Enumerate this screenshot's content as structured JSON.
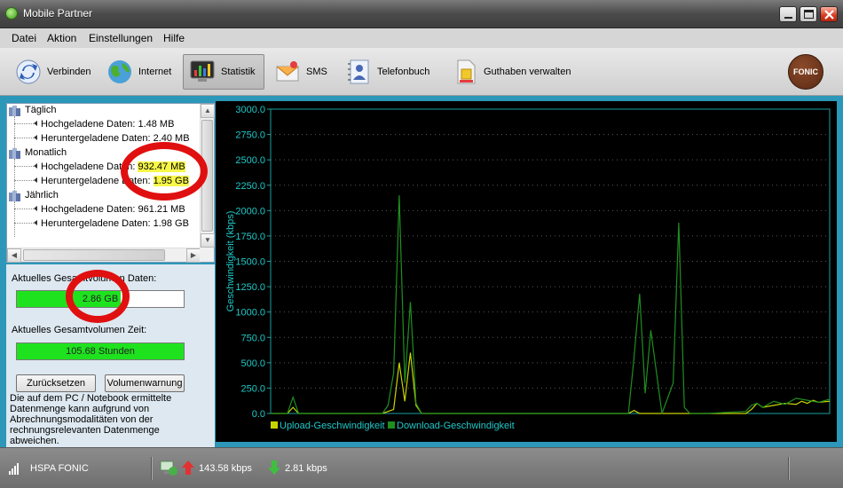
{
  "window": {
    "title": "Mobile Partner"
  },
  "menu": [
    {
      "label": "Datei"
    },
    {
      "label": "Aktion"
    },
    {
      "label": "Einstellungen"
    },
    {
      "label": "Hilfe"
    }
  ],
  "toolbar": {
    "items": [
      {
        "label": "Verbinden",
        "icon": "connect-icon"
      },
      {
        "label": "Internet",
        "icon": "globe-icon"
      },
      {
        "label": "Statistik",
        "icon": "statistics-icon",
        "active": true
      },
      {
        "label": "SMS",
        "icon": "envelope-icon"
      },
      {
        "label": "Telefonbuch",
        "icon": "phonebook-icon"
      },
      {
        "label": "Guthaben verwalten",
        "icon": "sim-card-icon"
      }
    ],
    "brand": "FONIC"
  },
  "tree": {
    "daily": {
      "label": "Täglich",
      "uploaded": "Hochgeladene Daten: 1.48 MB",
      "downloaded": "Heruntergeladene Daten: 2.40 MB"
    },
    "monthly": {
      "label": "Monatlich",
      "uploaded_label": "Hochgeladene Daten:",
      "uploaded_value": "932.47 MB",
      "downloaded_label": "Heruntergeladene Daten:",
      "downloaded_value": "1.95 GB"
    },
    "yearly": {
      "label": "Jährlich",
      "uploaded": "Hochgeladene Daten: 961.21 MB",
      "downloaded": "Heruntergeladene Daten: 1.98 GB"
    }
  },
  "totals": {
    "data_label": "Aktuelles Gesamtvolumen Daten:",
    "data_value": "2.86 GB",
    "data_fill": 0.62,
    "time_label": "Aktuelles Gesamtvolumen Zeit:",
    "time_value": "105.68 Stunden",
    "time_fill": 1.0,
    "reset_button": "Zurücksetzen",
    "warning_button": "Volumenwarnung",
    "info": "Die auf dem PC / Notebook ermittelte Datenmenge kann aufgrund von Abrechnungsmodalitäten von der rechnungsrelevanten Datenmenge abweichen."
  },
  "chart_data": {
    "type": "line",
    "ylabel": "Geschwindigkeit (kbps)",
    "ylim": [
      0,
      3000
    ],
    "yticks": [
      "3000.0",
      "2750.0",
      "2500.0",
      "2250.0",
      "2000.0",
      "1750.0",
      "1500.0",
      "1250.0",
      "1000.0",
      "750.0",
      "500.0",
      "250.0",
      "0.0"
    ],
    "grid": true,
    "legend_position": "bottom-left",
    "series": [
      {
        "name": "Upload-Geschwindigkeit",
        "color": "#c8d400",
        "x": [
          0,
          3,
          4,
          5,
          10,
          20,
          22,
          23,
          24,
          25,
          26,
          27,
          28,
          30,
          35,
          40,
          50,
          60,
          64,
          65,
          66,
          67,
          70,
          75,
          80,
          85,
          86,
          87,
          88,
          90,
          92,
          94,
          95,
          96,
          97,
          98,
          100
        ],
        "values": [
          0,
          0,
          60,
          0,
          0,
          0,
          40,
          500,
          120,
          600,
          80,
          0,
          0,
          0,
          0,
          0,
          0,
          0,
          0,
          30,
          0,
          0,
          0,
          0,
          0,
          0,
          40,
          100,
          60,
          80,
          100,
          90,
          120,
          100,
          130,
          110,
          120
        ]
      },
      {
        "name": "Download-Geschwindigkeit",
        "color": "#1f8f1f",
        "x": [
          0,
          3,
          4,
          5,
          10,
          20,
          21,
          22,
          23,
          24,
          25,
          26,
          27,
          28,
          30,
          40,
          50,
          64,
          65,
          66,
          67,
          68,
          70,
          72,
          73,
          74,
          75,
          76,
          78,
          85,
          86,
          87,
          88,
          90,
          92,
          94,
          96,
          98,
          100
        ],
        "values": [
          0,
          0,
          160,
          0,
          0,
          0,
          80,
          400,
          2150,
          300,
          1100,
          100,
          0,
          0,
          0,
          0,
          0,
          0,
          550,
          1180,
          200,
          820,
          0,
          300,
          1880,
          60,
          0,
          0,
          0,
          20,
          80,
          100,
          60,
          120,
          90,
          150,
          130,
          110,
          140
        ]
      }
    ]
  },
  "status": {
    "network": "HSPA FONIC",
    "upload_speed": "143.58 kbps",
    "download_speed": "2.81 kbps"
  }
}
